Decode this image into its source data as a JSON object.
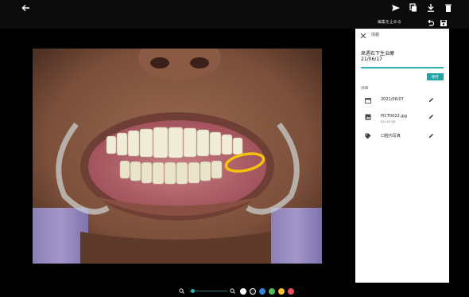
{
  "topbar": {
    "icons": [
      "back-arrow-icon",
      "send-icon",
      "copy-icon",
      "download-icon",
      "trash-icon"
    ]
  },
  "toolbar": {
    "stop_label": "編集を止める",
    "icons": [
      "undo-icon",
      "save-icon"
    ]
  },
  "info_panel": {
    "title": "情報",
    "note": "来週右下生治療\n21/06/17",
    "save_label": "保存",
    "details_label": "詳細",
    "rows": [
      {
        "icon": "calendar-icon",
        "text": "2021/06/07",
        "subtext": ""
      },
      {
        "icon": "image-icon",
        "text": "PICT0022.jpg",
        "subtext": "624.05 KB"
      },
      {
        "icon": "tag-icon",
        "text": "口腔内写真",
        "subtext": ""
      }
    ],
    "accent_color": "#2bb3b1"
  },
  "zoom": {
    "level": 0.1
  },
  "annotation": {
    "stroke_color": "#f5c20a"
  },
  "palette": {
    "colors": [
      "#ffffff",
      "#1a1a1a",
      "#2f86d6",
      "#4fba5a",
      "#f2c531",
      "#ea4d5a"
    ],
    "selected_index": 1
  }
}
